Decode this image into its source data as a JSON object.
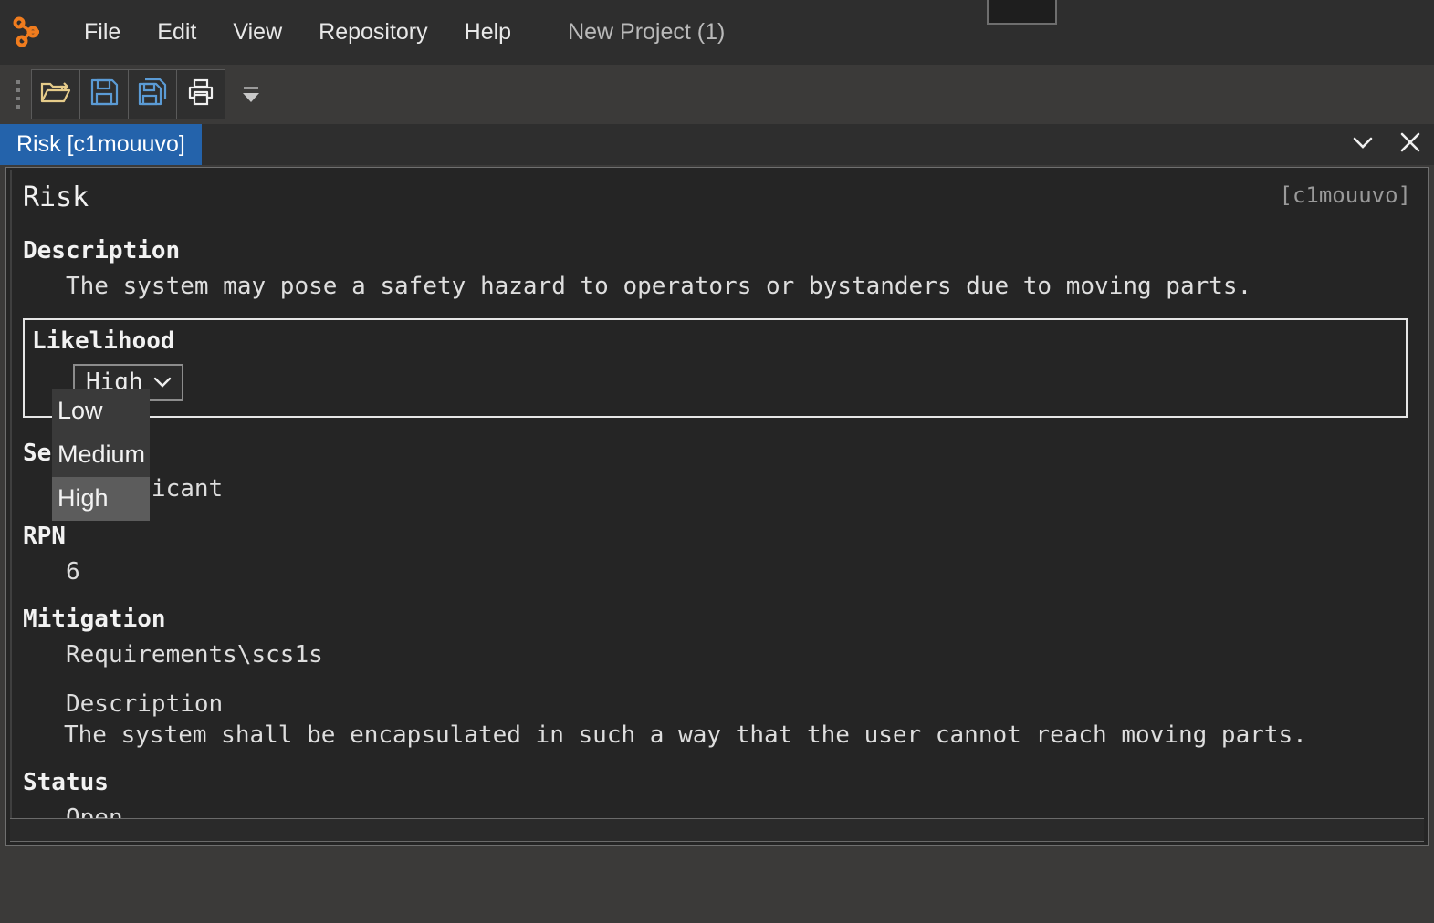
{
  "window": {
    "drag_handle": "window-drag-handle"
  },
  "menubar": {
    "logo_icon": "graph-nodes-logo-icon",
    "items": [
      {
        "label": "File"
      },
      {
        "label": "Edit"
      },
      {
        "label": "View"
      },
      {
        "label": "Repository"
      },
      {
        "label": "Help"
      }
    ],
    "project": "New Project (1)"
  },
  "toolbar": {
    "grip_icon": "toolbar-grip-icon",
    "buttons": [
      {
        "name": "open-project-button",
        "icon": "open-folder-icon"
      },
      {
        "name": "save-button",
        "icon": "save-floppy-icon"
      },
      {
        "name": "save-as-button",
        "icon": "save-as-floppy-icon"
      },
      {
        "name": "print-button",
        "icon": "printer-icon"
      }
    ],
    "overflow_icon": "toolbar-overflow-icon"
  },
  "tabbar": {
    "tabs": [
      {
        "label": "Risk [c1mouuvo]",
        "active": true
      }
    ],
    "chevron_icon": "chevron-down-icon",
    "close_icon": "close-icon"
  },
  "document": {
    "title": "Risk",
    "uid": "[c1mouuvo]",
    "fields": {
      "description_label": "Description",
      "description_value": "The system may pose a safety hazard to operators or bystanders due to moving parts.",
      "likelihood_label": "Likelihood",
      "likelihood_value": "High",
      "severity_label": "Severity",
      "severity_value": "Significant",
      "rpn_label": "RPN",
      "rpn_value": "6",
      "mitigation_label": "Mitigation",
      "mitigation_ref": "Requirements\\scs1s",
      "mitigation_desc_label": "Description",
      "mitigation_desc_value": "The system shall be encapsulated in such a way that the user cannot reach moving parts.",
      "status_label": "Status",
      "status_value": "Open"
    }
  },
  "dropdown": {
    "options": [
      {
        "label": "Low",
        "selected": false
      },
      {
        "label": "Medium",
        "selected": false
      },
      {
        "label": "High",
        "selected": true
      }
    ]
  },
  "colors": {
    "accent": "#2463ab",
    "panel_bg": "#252525",
    "menubar_bg": "#2e2e2e",
    "toolbar_bg": "#3b3a39",
    "logo_orange": "#f07c1e",
    "icon_blue": "#5b9bd5",
    "icon_yellow": "#e6cc8a"
  }
}
